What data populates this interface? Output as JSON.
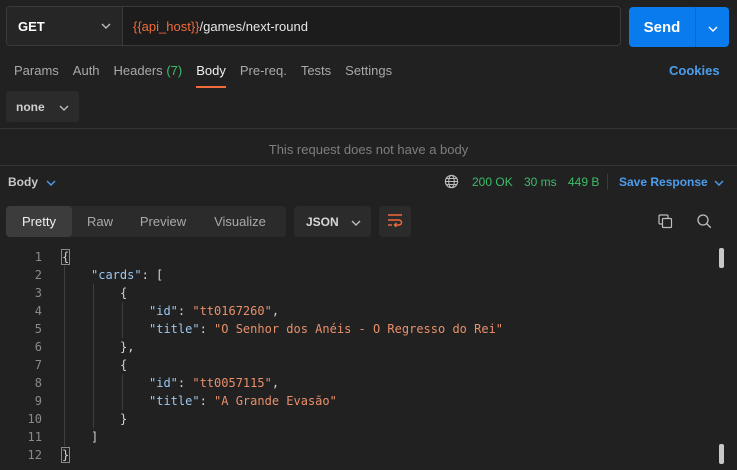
{
  "request": {
    "method": "GET",
    "url_var": "{{api_host}}",
    "url_path": "/games/next-round",
    "send_label": "Send"
  },
  "req_tabs": [
    {
      "label": "Params"
    },
    {
      "label": "Auth"
    },
    {
      "label": "Headers",
      "count": "(7)"
    },
    {
      "label": "Body",
      "active": true
    },
    {
      "label": "Pre-req."
    },
    {
      "label": "Tests"
    },
    {
      "label": "Settings"
    }
  ],
  "cookies_label": "Cookies",
  "body_type": "none",
  "no_body_message": "This request does not have a body",
  "response": {
    "body_label": "Body",
    "status": "200 OK",
    "time": "30 ms",
    "size": "449 B",
    "save_label": "Save Response",
    "view_tabs": [
      "Pretty",
      "Raw",
      "Preview",
      "Visualize"
    ],
    "format": "JSON"
  },
  "code": {
    "line_numbers": [
      "1",
      "2",
      "3",
      "4",
      "5",
      "6",
      "7",
      "8",
      "9",
      "10",
      "11",
      "12"
    ],
    "lines": [
      {
        "indent": 0,
        "parts": [
          [
            "p",
            "{"
          ]
        ]
      },
      {
        "indent": 1,
        "parts": [
          [
            "k",
            "\"cards\""
          ],
          [
            "p",
            ": ["
          ]
        ]
      },
      {
        "indent": 2,
        "parts": [
          [
            "p",
            "{"
          ]
        ]
      },
      {
        "indent": 3,
        "parts": [
          [
            "k",
            "\"id\""
          ],
          [
            "p",
            ": "
          ],
          [
            "s",
            "\"tt0167260\""
          ],
          [
            "p",
            ","
          ]
        ]
      },
      {
        "indent": 3,
        "parts": [
          [
            "k",
            "\"title\""
          ],
          [
            "p",
            ": "
          ],
          [
            "s",
            "\"O Senhor dos Anéis - O Regresso do Rei\""
          ]
        ]
      },
      {
        "indent": 2,
        "parts": [
          [
            "p",
            "},"
          ]
        ]
      },
      {
        "indent": 2,
        "parts": [
          [
            "p",
            "{"
          ]
        ]
      },
      {
        "indent": 3,
        "parts": [
          [
            "k",
            "\"id\""
          ],
          [
            "p",
            ": "
          ],
          [
            "s",
            "\"tt0057115\""
          ],
          [
            "p",
            ","
          ]
        ]
      },
      {
        "indent": 3,
        "parts": [
          [
            "k",
            "\"title\""
          ],
          [
            "p",
            ": "
          ],
          [
            "s",
            "\"A Grande Evasão\""
          ]
        ]
      },
      {
        "indent": 2,
        "parts": [
          [
            "p",
            "}"
          ]
        ]
      },
      {
        "indent": 1,
        "parts": [
          [
            "p",
            "]"
          ]
        ]
      },
      {
        "indent": 0,
        "parts": [
          [
            "p",
            "}"
          ]
        ]
      }
    ]
  },
  "colors": {
    "accent": "#f26b3a",
    "send": "#097bed",
    "link": "#4c9eed",
    "success": "#3bbd6a"
  },
  "icons": [
    "chevron-down-icon",
    "globe-icon",
    "wrap-icon",
    "copy-icon",
    "search-icon"
  ]
}
